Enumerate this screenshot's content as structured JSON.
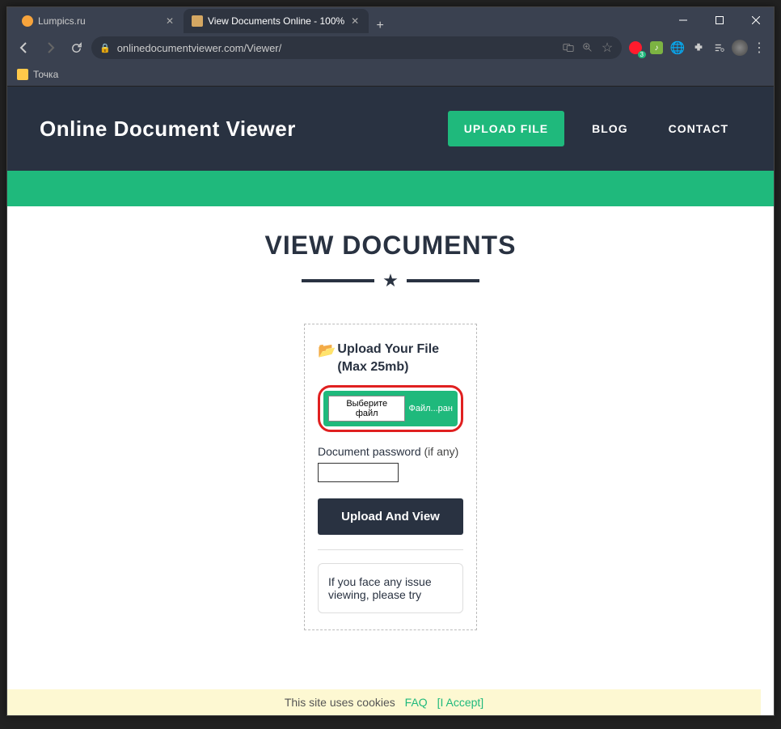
{
  "tabs": [
    {
      "title": "Lumpics.ru",
      "favicon_color": "#f7a43c"
    },
    {
      "title": "View Documents Online - 100% ",
      "favicon_color": "#d4a762"
    }
  ],
  "url": "onlinedocumentviewer.com/Viewer/",
  "bookmark": "Точка",
  "site": {
    "title": "Online Document Viewer",
    "nav": {
      "upload": "UPLOAD FILE",
      "blog": "BLOG",
      "contact": "CONTACT"
    }
  },
  "page": {
    "heading": "VIEW DOCUMENTS",
    "upload_label": "Upload Your File (Max 25mb)",
    "file_button": "Выберите файл",
    "file_status": "Файл...ран",
    "pw_label": "Document password",
    "pw_label_suffix": "(if any)",
    "submit": "Upload And View",
    "info": "If you face any issue viewing, please try"
  },
  "cookies": {
    "text": "This site uses cookies",
    "faq": "FAQ",
    "accept": "[I Accept]"
  },
  "ext_badge": "3"
}
